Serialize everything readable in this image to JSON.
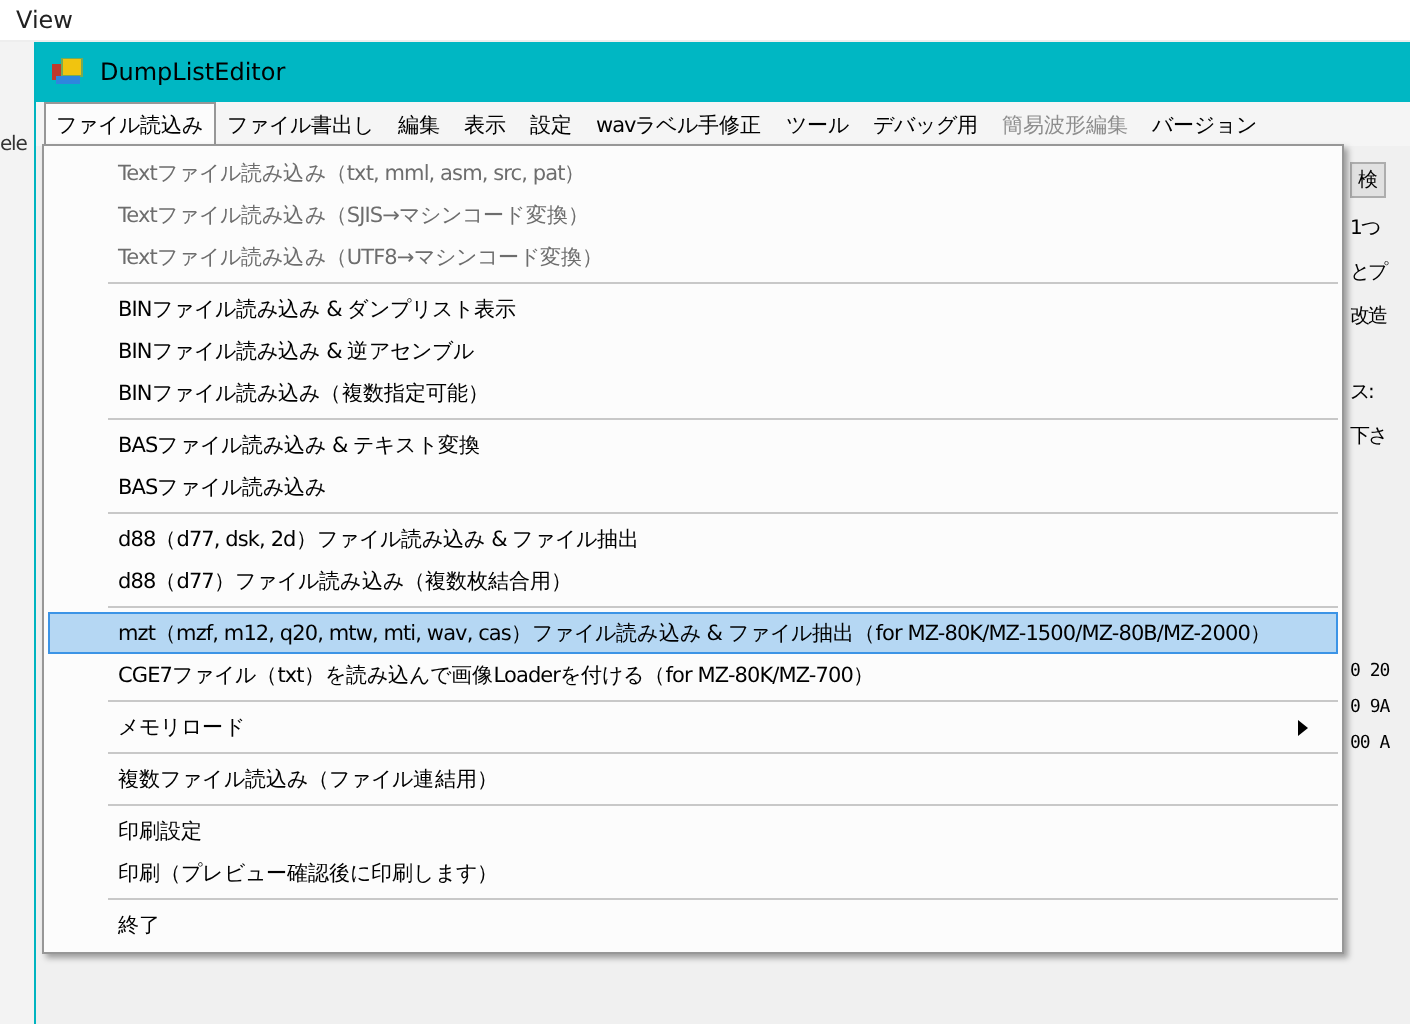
{
  "host": {
    "menu_label": "View",
    "side_label": "ele"
  },
  "window": {
    "title": "DumpListEditor"
  },
  "menubar": [
    {
      "label": "ファイル読込み",
      "selected": true,
      "disabled": false
    },
    {
      "label": "ファイル書出し",
      "selected": false,
      "disabled": false
    },
    {
      "label": "編集",
      "selected": false,
      "disabled": false
    },
    {
      "label": "表示",
      "selected": false,
      "disabled": false
    },
    {
      "label": "設定",
      "selected": false,
      "disabled": false
    },
    {
      "label": "wavラベル手修正",
      "selected": false,
      "disabled": false
    },
    {
      "label": "ツール",
      "selected": false,
      "disabled": false
    },
    {
      "label": "デバッグ用",
      "selected": false,
      "disabled": false
    },
    {
      "label": "簡易波形編集",
      "selected": false,
      "disabled": true
    },
    {
      "label": "バージョン",
      "selected": false,
      "disabled": false
    }
  ],
  "background_fragments": {
    "search_button": "検",
    "lines": [
      "1つ",
      "とプ",
      "改造"
    ],
    "address_label": "ス:",
    "hint": "下さ",
    "dump_lines": [
      "0 20",
      "0 9A",
      "00 A"
    ]
  },
  "dropdown": [
    {
      "kind": "item",
      "label": "Textファイル読み込み（txt, mml, asm, src, pat）",
      "disabled": true,
      "selected": false,
      "submenu": false
    },
    {
      "kind": "item",
      "label": "Textファイル読み込み（SJIS→マシンコード変換）",
      "disabled": true,
      "selected": false,
      "submenu": false
    },
    {
      "kind": "item",
      "label": "Textファイル読み込み（UTF8→マシンコード変換）",
      "disabled": true,
      "selected": false,
      "submenu": false
    },
    {
      "kind": "separator"
    },
    {
      "kind": "item",
      "label": "BINファイル読み込み & ダンプリスト表示",
      "disabled": false,
      "selected": false,
      "submenu": false
    },
    {
      "kind": "item",
      "label": "BINファイル読み込み & 逆アセンブル",
      "disabled": false,
      "selected": false,
      "submenu": false
    },
    {
      "kind": "item",
      "label": "BINファイル読み込み（複数指定可能）",
      "disabled": false,
      "selected": false,
      "submenu": false
    },
    {
      "kind": "separator"
    },
    {
      "kind": "item",
      "label": "BASファイル読み込み & テキスト変換",
      "disabled": false,
      "selected": false,
      "submenu": false
    },
    {
      "kind": "item",
      "label": "BASファイル読み込み",
      "disabled": false,
      "selected": false,
      "submenu": false
    },
    {
      "kind": "separator"
    },
    {
      "kind": "item",
      "label": "d88（d77, dsk, 2d）ファイル読み込み & ファイル抽出",
      "disabled": false,
      "selected": false,
      "submenu": false
    },
    {
      "kind": "item",
      "label": "d88（d77）ファイル読み込み（複数枚結合用）",
      "disabled": false,
      "selected": false,
      "submenu": false
    },
    {
      "kind": "separator"
    },
    {
      "kind": "item",
      "label": "mzt（mzf, m12, q20, mtw, mti, wav, cas）ファイル読み込み & ファイル抽出（for MZ-80K/MZ-1500/MZ-80B/MZ-2000）",
      "disabled": false,
      "selected": true,
      "submenu": false
    },
    {
      "kind": "item",
      "label": "CGE7ファイル（txt）を読み込んで画像Loaderを付ける（for MZ-80K/MZ-700）",
      "disabled": false,
      "selected": false,
      "submenu": false
    },
    {
      "kind": "separator"
    },
    {
      "kind": "item",
      "label": "メモリロード",
      "disabled": false,
      "selected": false,
      "submenu": true
    },
    {
      "kind": "separator"
    },
    {
      "kind": "item",
      "label": "複数ファイル読込み（ファイル連結用）",
      "disabled": false,
      "selected": false,
      "submenu": false
    },
    {
      "kind": "separator"
    },
    {
      "kind": "item",
      "label": "印刷設定",
      "disabled": false,
      "selected": false,
      "submenu": false
    },
    {
      "kind": "item",
      "label": "印刷（プレビュー確認後に印刷します）",
      "disabled": false,
      "selected": false,
      "submenu": false
    },
    {
      "kind": "separator"
    },
    {
      "kind": "item",
      "label": "終了",
      "disabled": false,
      "selected": false,
      "submenu": false
    }
  ]
}
